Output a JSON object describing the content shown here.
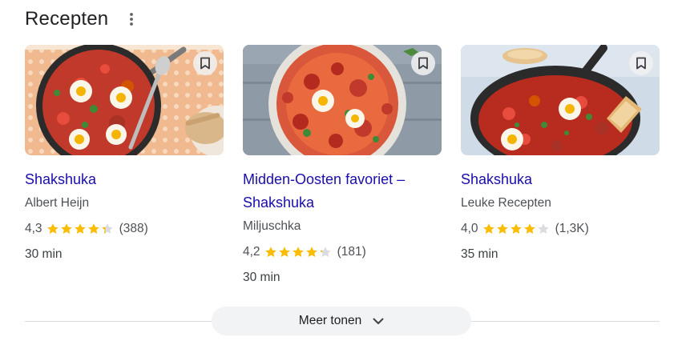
{
  "header": {
    "title": "Recepten"
  },
  "recipes": [
    {
      "title": "Shakshuka",
      "source": "Albert Heijn",
      "rating": "4,3",
      "stars": 4.3,
      "count": "(388)",
      "time": "30 min"
    },
    {
      "title": "Midden-Oosten favoriet – Shakshuka",
      "source": "Miljuschka",
      "rating": "4,2",
      "stars": 4.2,
      "count": "(181)",
      "time": "30 min"
    },
    {
      "title": "Shakshuka",
      "source": "Leuke Recepten",
      "rating": "4,0",
      "stars": 4.0,
      "count": "(1,3K)",
      "time": "35 min"
    }
  ],
  "more_button": {
    "label": "Meer tonen"
  },
  "colors": {
    "link": "#1a0dab",
    "star_filled": "#fbbc04",
    "star_empty": "#dadce0",
    "secondary_text": "#4d5156"
  },
  "icons": {
    "menu": "more-vert-icon",
    "bookmark": "bookmark-icon",
    "expand": "chevron-down-icon",
    "star": "star-icon"
  }
}
